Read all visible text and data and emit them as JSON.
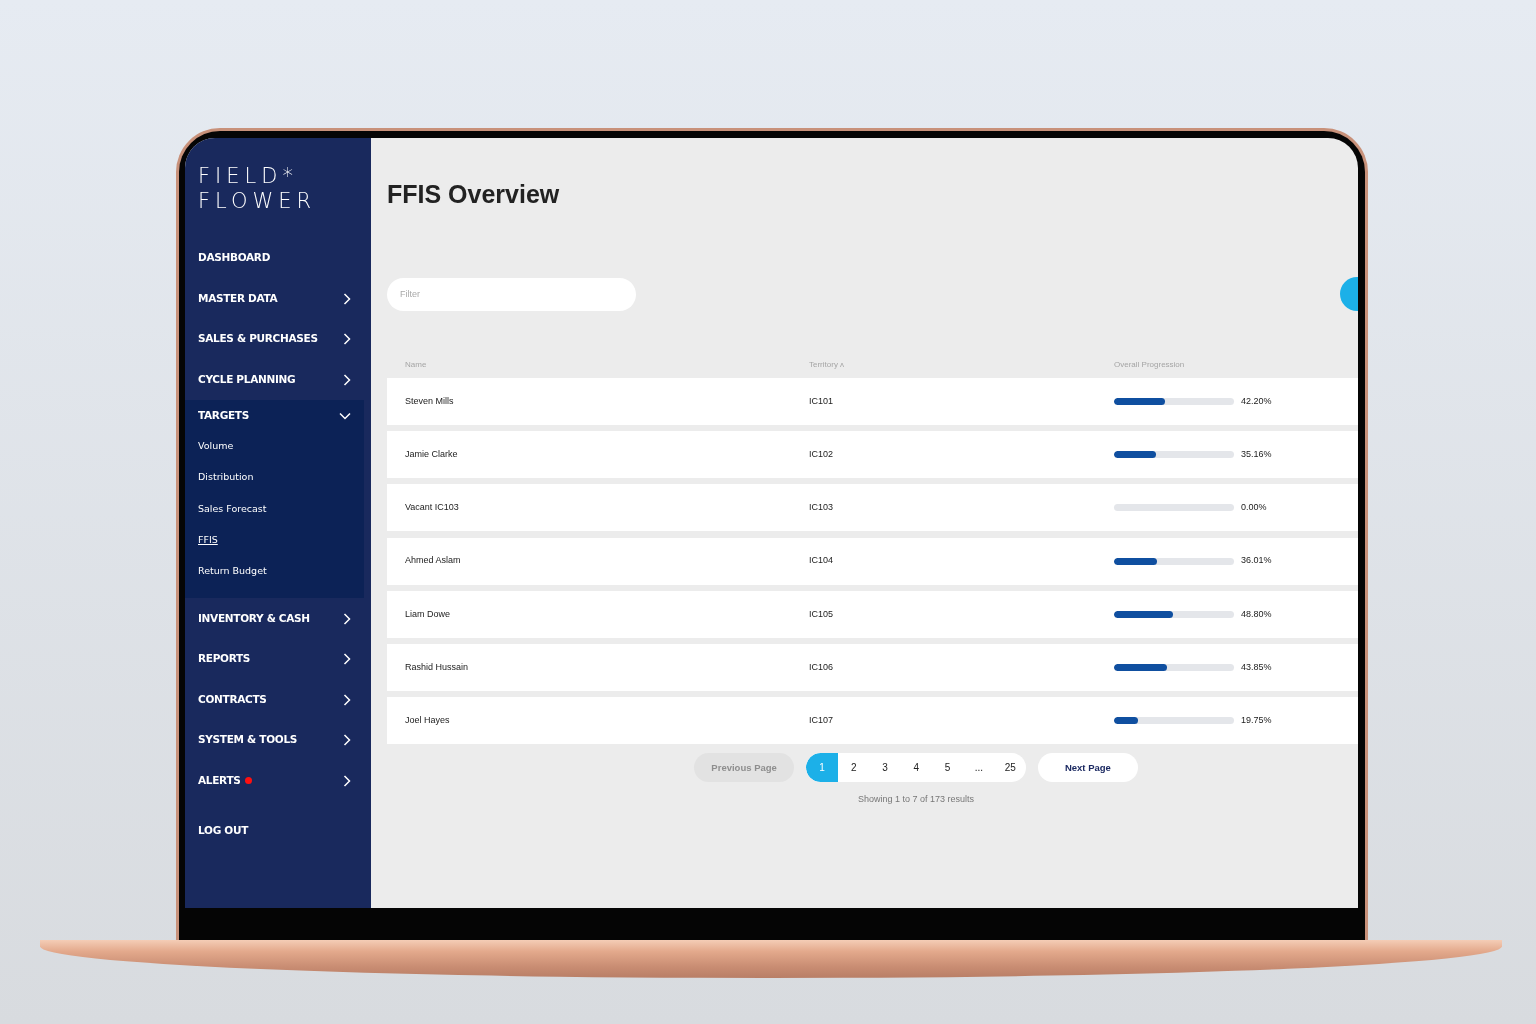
{
  "logo": {
    "line_1": "FIELD*",
    "line_2": "FLOWER"
  },
  "sidebar": {
    "items": [
      {
        "label": "DASHBOARD",
        "kind": "link"
      },
      {
        "label": "MASTER DATA",
        "kind": "group",
        "expanded": false
      },
      {
        "label": "SALES & PURCHASES",
        "kind": "group",
        "expanded": false
      },
      {
        "label": "CYCLE PLANNING",
        "kind": "group",
        "expanded": false
      },
      {
        "label": "TARGETS",
        "kind": "group",
        "expanded": true,
        "children": [
          {
            "label": "Volume",
            "selected": false
          },
          {
            "label": "Distribution",
            "selected": false
          },
          {
            "label": "Sales Forecast",
            "selected": false
          },
          {
            "label": "FFIS",
            "selected": true
          },
          {
            "label": "Return Budget",
            "selected": false
          }
        ]
      },
      {
        "label": "INVENTORY & CASH",
        "kind": "group",
        "expanded": false
      },
      {
        "label": "REPORTS",
        "kind": "group",
        "expanded": false
      },
      {
        "label": "CONTRACTS",
        "kind": "group",
        "expanded": false
      },
      {
        "label": "SYSTEM & TOOLS",
        "kind": "group",
        "expanded": false
      },
      {
        "label": "ALERTS",
        "kind": "group",
        "expanded": false,
        "notification": true
      },
      {
        "label": "LOG OUT",
        "kind": "logout"
      }
    ]
  },
  "page": {
    "title": "FFIS Overview"
  },
  "filter": {
    "placeholder": "Filter"
  },
  "table": {
    "columns": [
      "Name",
      "Territory ʌ",
      "Overall Progression"
    ],
    "rows": [
      {
        "name": "Steven Mills",
        "territory": "IC101",
        "level": 0.422,
        "reading": "42.20%"
      },
      {
        "name": "Jamie Clarke",
        "territory": "IC102",
        "level": 0.3516,
        "reading": "35.16%"
      },
      {
        "name": "Vacant IC103",
        "territory": "IC103",
        "reading": "0.00%"
      },
      {
        "name": "Ahmed Aslam",
        "territory": "IC104",
        "level": 0.3601,
        "reading": "36.01%"
      },
      {
        "name": "Liam Dowe",
        "territory": "IC105",
        "level": 0.488,
        "reading": "48.80%"
      },
      {
        "name": "Rashid Hussain",
        "territory": "IC106",
        "level": 0.4385,
        "reading": "43.85%"
      },
      {
        "name": "Joel Hayes",
        "territory": "IC107",
        "level": 0.1975,
        "reading": "19.75%"
      }
    ]
  },
  "pagination": {
    "previous": {
      "label": "Previous Page",
      "disabled": true
    },
    "pages": [
      {
        "label": "1",
        "selected": true
      },
      {
        "label": "2",
        "selected": false
      },
      {
        "label": "3",
        "selected": false
      },
      {
        "label": "4",
        "selected": false
      },
      {
        "label": "5",
        "selected": false
      },
      {
        "label": "...",
        "selected": false
      },
      {
        "label": "25",
        "selected": false
      }
    ],
    "next": {
      "label": "Next Page",
      "disabled": false
    },
    "summary": "Showing 1 to 7 of 173 results"
  }
}
